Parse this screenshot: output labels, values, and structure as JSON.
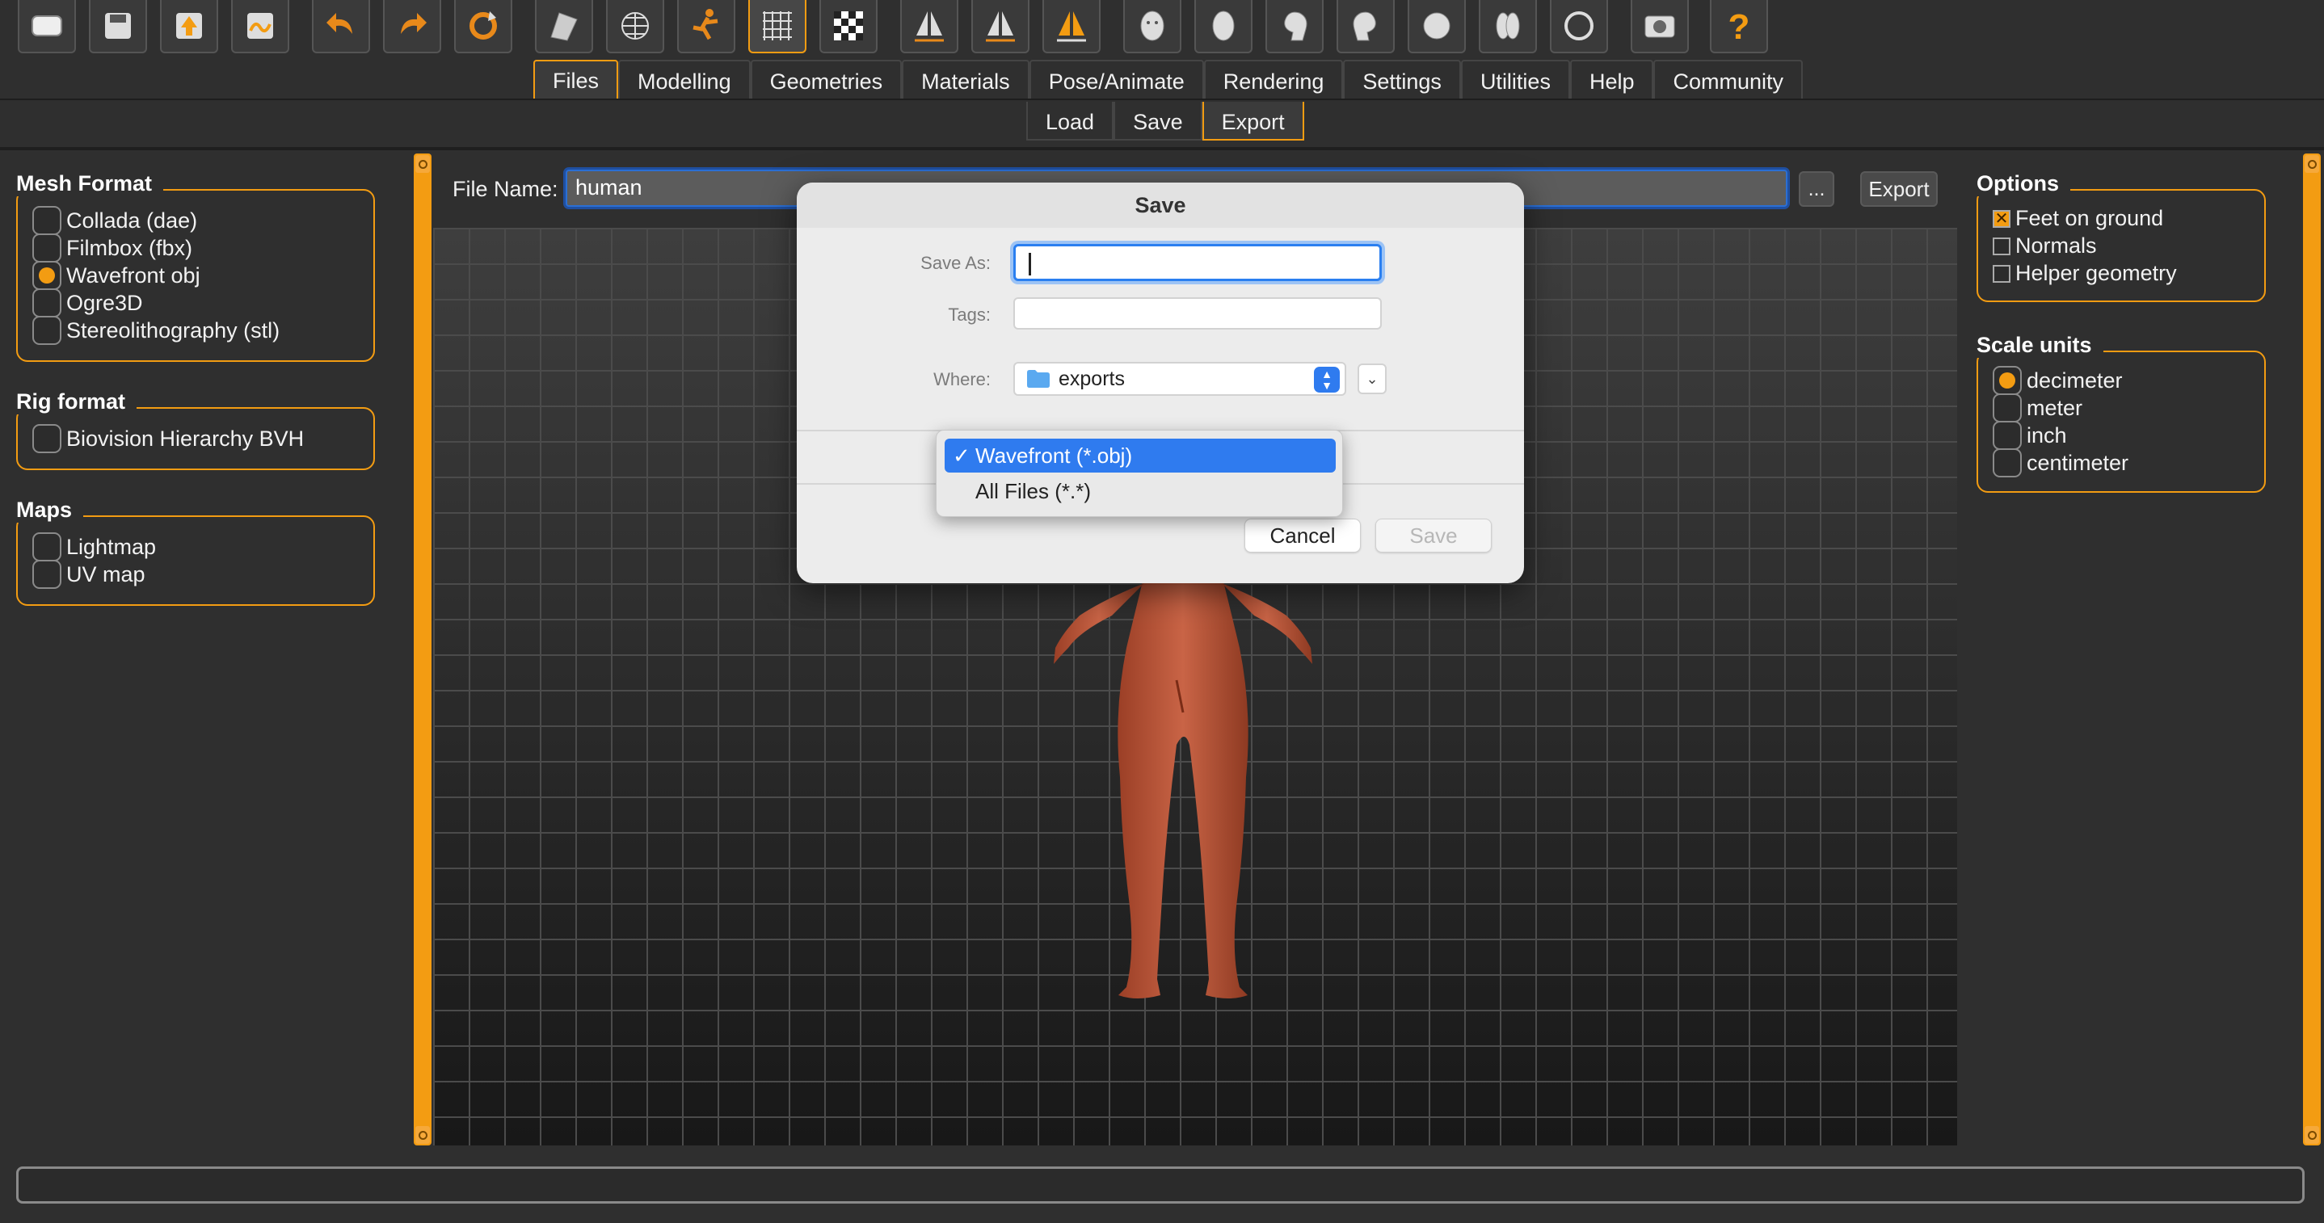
{
  "toolbar": {
    "icons": [
      "window-icon",
      "save-disk-icon",
      "load-arrow-icon",
      "export-wave-icon",
      "undo-icon",
      "redo-icon",
      "reset-icon",
      "smooth-icon",
      "wireframe-icon",
      "pose-icon",
      "grid-icon",
      "checker-icon",
      "front-view-icon",
      "back-view-icon",
      "side-view-icon",
      "face-mask-icon",
      "head-front-icon",
      "head-side-icon",
      "head-right-icon",
      "head-top-icon",
      "head-back-icon",
      "circle-icon",
      "screenshot-camera-icon",
      "help-question-icon"
    ]
  },
  "tabs": [
    "Files",
    "Modelling",
    "Geometries",
    "Materials",
    "Pose/Animate",
    "Rendering",
    "Settings",
    "Utilities",
    "Help",
    "Community"
  ],
  "active_tab": "Files",
  "subtabs": [
    "Load",
    "Save",
    "Export"
  ],
  "active_subtab": "Export",
  "left_panel": {
    "mesh_format": {
      "title": "Mesh Format",
      "options": [
        "Collada (dae)",
        "Filmbox (fbx)",
        "Wavefront obj",
        "Ogre3D",
        "Stereolithography (stl)"
      ],
      "selected": "Wavefront obj"
    },
    "rig_format": {
      "title": "Rig format",
      "options": [
        "Biovision Hierarchy BVH"
      ]
    },
    "maps": {
      "title": "Maps",
      "options": [
        "Lightmap",
        "UV map"
      ]
    }
  },
  "file_name": {
    "label": "File Name:",
    "value": "human",
    "browse": "...",
    "export": "Export"
  },
  "right_panel": {
    "options": {
      "title": "Options",
      "items": [
        {
          "label": "Feet on ground",
          "checked": true
        },
        {
          "label": "Normals",
          "checked": false
        },
        {
          "label": "Helper geometry",
          "checked": false
        }
      ]
    },
    "scale_units": {
      "title": "Scale units",
      "options": [
        "decimeter",
        "meter",
        "inch",
        "centimeter"
      ],
      "selected": "decimeter"
    }
  },
  "dialog": {
    "title": "Save",
    "save_as_label": "Save As:",
    "save_as_value": "",
    "tags_label": "Tags:",
    "where_label": "Where:",
    "where_value": "exports",
    "file_types": [
      "Wavefront (*.obj)",
      "All Files (*.*)"
    ],
    "selected_type": "Wavefront (*.obj)",
    "cancel": "Cancel",
    "save": "Save"
  },
  "colors": {
    "accent": "#f39c12",
    "selection": "#2f7bef",
    "body": "#c0573a"
  }
}
